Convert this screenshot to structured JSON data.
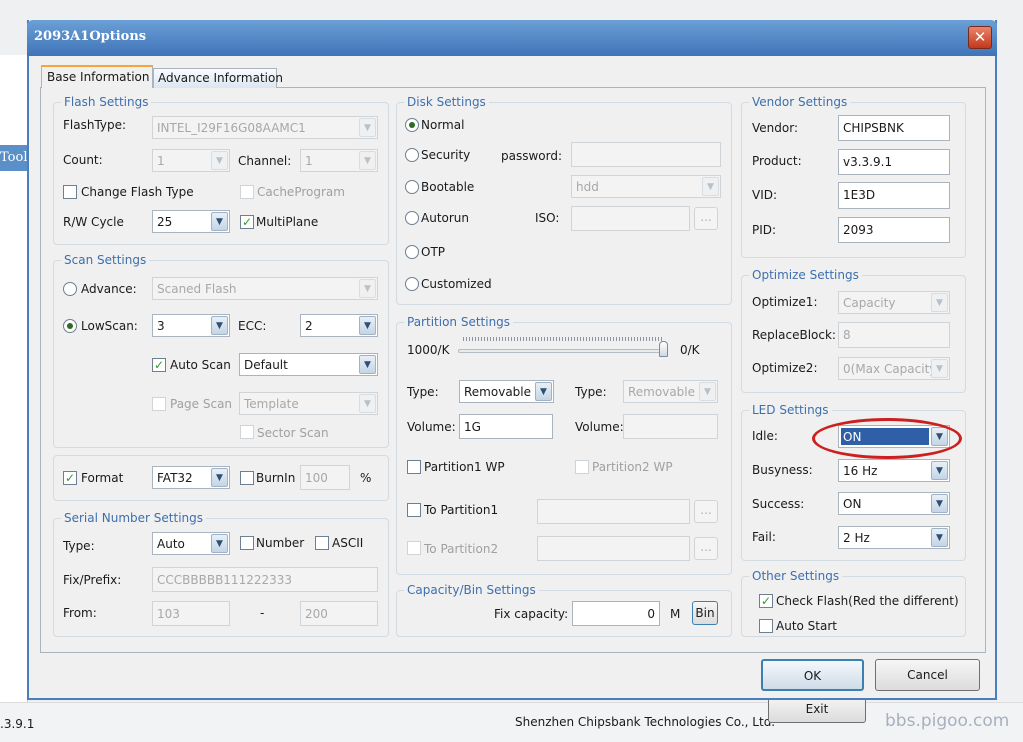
{
  "background": {
    "side_label": "Tool",
    "version": ".3.9.1",
    "company": "Shenzhen Chipsbank Technologies Co., Ltd.",
    "exit_label": "Exit",
    "watermark": "bbs.pigoo.com"
  },
  "dialog": {
    "title": "2093A1Options",
    "close_icon": "close-icon",
    "tabs": [
      {
        "label": "Base Information",
        "active": true
      },
      {
        "label": "Advance Information",
        "active": false
      }
    ],
    "ok_label": "OK",
    "cancel_label": "Cancel"
  },
  "flash": {
    "title": "Flash Settings",
    "flashtype_label": "FlashType:",
    "flashtype": "INTEL_I29F16G08AAMC1",
    "count_label": "Count:",
    "count": "1",
    "channel_label": "Channel:",
    "channel": "1",
    "change_flash_type": "Change Flash Type",
    "cache_program": "CacheProgram",
    "rw_cycle_label": "R/W Cycle",
    "rw_cycle": "25",
    "multiplane": "MultiPlane"
  },
  "scan": {
    "title": "Scan Settings",
    "advance_label": "Advance:",
    "advance_value": "Scaned Flash",
    "lowscan_label": "LowScan:",
    "lowscan_value": "3",
    "ecc_label": "ECC:",
    "ecc": "2",
    "auto_scan": "Auto Scan",
    "auto_scan_value": "Default",
    "page_scan": "Page Scan",
    "page_scan_value": "Template",
    "sector_scan": "Sector Scan"
  },
  "format": {
    "format_label": "Format",
    "format_value": "FAT32",
    "burnin_label": "BurnIn",
    "burnin_value": "100",
    "percent": "%"
  },
  "serial": {
    "title": "Serial Number Settings",
    "type_label": "Type:",
    "type": "Auto",
    "number": "Number",
    "ascii": "ASCII",
    "prefix_label": "Fix/Prefix:",
    "prefix": "CCCBBBBB111222333",
    "from_label": "From:",
    "from": "103",
    "dash": "-",
    "to": "200"
  },
  "disk": {
    "title": "Disk Settings",
    "normal": "Normal",
    "security": "Security",
    "password_label": "password:",
    "bootable": "Bootable",
    "bootable_value": "hdd",
    "autorun": "Autorun",
    "iso_label": "ISO:",
    "browse": "...",
    "otp": "OTP",
    "customized": "Customized"
  },
  "partition": {
    "title": "Partition Settings",
    "left_label": "1000/K",
    "right_label": "0/K",
    "slider_percent": 100,
    "type_label": "Type:",
    "type1": "Removable",
    "type2": "Removable",
    "volume_label": "Volume:",
    "volume1": "1G",
    "volume2": "",
    "p1wp": "Partition1 WP",
    "p2wp": "Partition2 WP",
    "to_p1": "To Partition1",
    "to_p2": "To Partition2",
    "browse": "..."
  },
  "capacity": {
    "title": "Capacity/Bin Settings",
    "fix_label": "Fix capacity:",
    "fix_value": "0",
    "unit": "M",
    "bin": "Bin"
  },
  "vendor": {
    "title": "Vendor Settings",
    "vendor_label": "Vendor:",
    "vendor": "CHIPSBNK",
    "product_label": "Product:",
    "product": "v3.3.9.1",
    "vid_label": "VID:",
    "vid": "1E3D",
    "pid_label": "PID:",
    "pid": "2093"
  },
  "optimize": {
    "title": "Optimize Settings",
    "opt1_label": "Optimize1:",
    "opt1": "Capacity",
    "replace_label": "ReplaceBlock:",
    "replace": "8",
    "opt2_label": "Optimize2:",
    "opt2": "0(Max Capacity"
  },
  "led": {
    "title": "LED Settings",
    "idle_label": "Idle:",
    "idle": "ON",
    "busy_label": "Busyness:",
    "busy": "16 Hz",
    "success_label": "Success:",
    "success": "ON",
    "fail_label": "Fail:",
    "fail": "2 Hz",
    "highlight_color": "#cc2020"
  },
  "other": {
    "title": "Other Settings",
    "check_flash": "Check Flash(Red the different)",
    "auto_start": "Auto Start"
  }
}
